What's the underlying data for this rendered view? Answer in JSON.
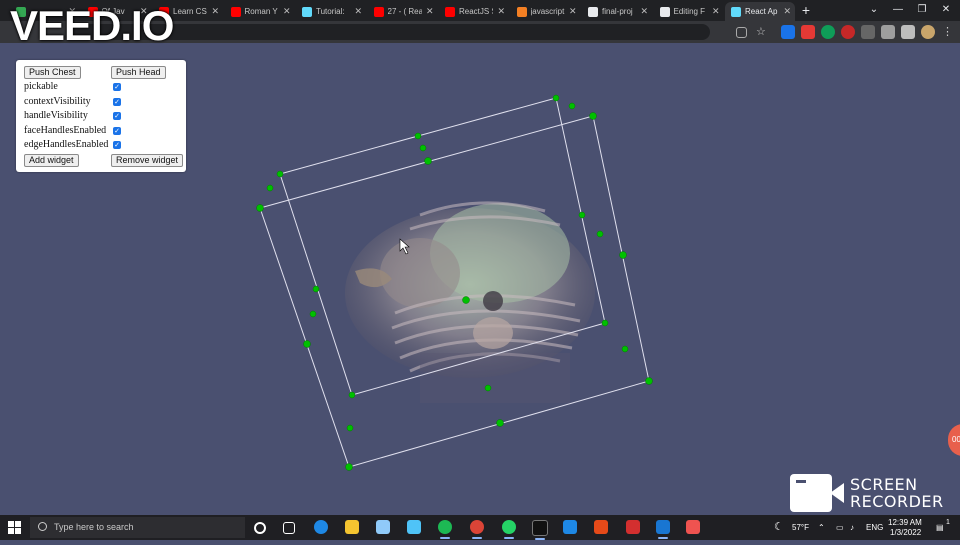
{
  "tabs": [
    {
      "title": "",
      "icon": "green-doc-icon",
      "color": "#34a853",
      "active": false
    },
    {
      "title": "Of Jav",
      "icon": "youtube-icon",
      "color": "#ff0000",
      "active": false
    },
    {
      "title": "Learn CS",
      "icon": "youtube-icon",
      "color": "#ff0000",
      "active": false
    },
    {
      "title": "Roman Y",
      "icon": "youtube-icon",
      "color": "#ff0000",
      "active": false
    },
    {
      "title": "Tutorial:",
      "icon": "react-icon",
      "color": "#61dafb",
      "active": false
    },
    {
      "title": "27 - ( Rea",
      "icon": "youtube-icon",
      "color": "#ff0000",
      "active": false
    },
    {
      "title": "ReactJS S",
      "icon": "youtube-icon",
      "color": "#ff0000",
      "active": false
    },
    {
      "title": "javascript",
      "icon": "stackoverflow-icon",
      "color": "#f48024",
      "active": false
    },
    {
      "title": "final-proj",
      "icon": "github-icon",
      "color": "#e8eaed",
      "active": false
    },
    {
      "title": "Editing F",
      "icon": "github-icon",
      "color": "#e8eaed",
      "active": false
    },
    {
      "title": "React Ap",
      "icon": "react-icon",
      "color": "#61dafb",
      "active": true
    }
  ],
  "watermark": "VEED.IO",
  "panel": {
    "push_chest": "Push Chest",
    "push_head": "Push Head",
    "options": [
      {
        "label": "pickable",
        "checked": true
      },
      {
        "label": "contextVisibility",
        "checked": true
      },
      {
        "label": "handleVisibility",
        "checked": true
      },
      {
        "label": "faceHandlesEnabled",
        "checked": true
      },
      {
        "label": "edgeHandlesEnabled",
        "checked": true
      }
    ],
    "add_widget": "Add widget",
    "remove_widget": "Remove widget"
  },
  "recorder": {
    "line1": "SCREEN",
    "line2": "RECORDER"
  },
  "badge": "00",
  "taskbar": {
    "search_placeholder": "Type here to search",
    "weather": "57°F",
    "language": "ENG",
    "time": "12:39 AM",
    "date": "1/3/2022",
    "notifications": "1"
  },
  "colors": {
    "viewport_bg": "#4a5070",
    "handle": "#00c000",
    "widget_outline": "#e0e0ee"
  }
}
